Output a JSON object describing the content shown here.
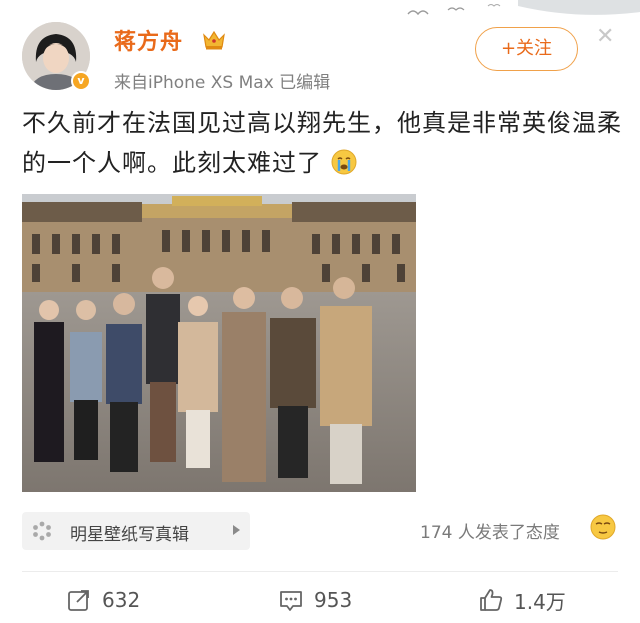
{
  "header": {
    "username": "蒋方舟",
    "source": "来自iPhone XS Max  已编辑",
    "follow_label": "+关注",
    "verified_badge": "v",
    "avatar_icon": "user-avatar"
  },
  "post": {
    "text": "不久前才在法国见过高以翔先生，他真是非常英俊温柔的一个人啊。此刻太难过了",
    "emoji": "crying-face-icon"
  },
  "topic": {
    "label": "明星壁纸写真辑",
    "icon": "topic-asterisk-icon"
  },
  "reactions_text": "174 人发表了态度",
  "actions": {
    "repost_count": "632",
    "comment_count": "953",
    "like_count": "1.4万"
  },
  "colors": {
    "brand_orange": "#e96a1a",
    "follow_border": "#f0a14a",
    "verified_gold": "#f6a623",
    "muted_text": "#808080"
  }
}
